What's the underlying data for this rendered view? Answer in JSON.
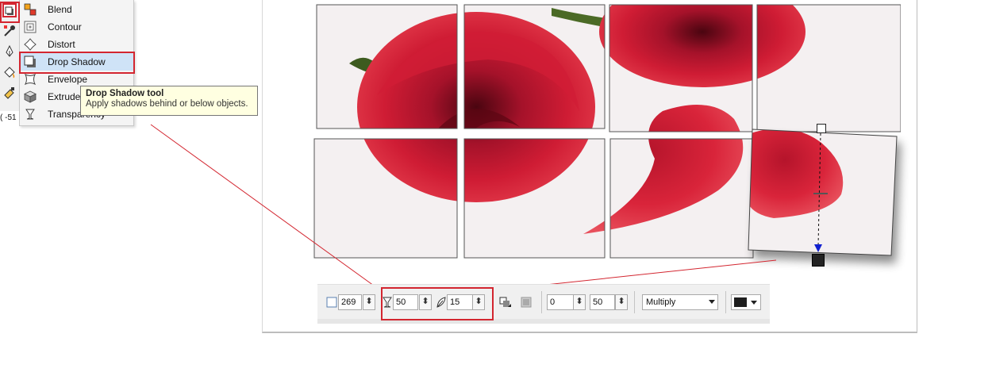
{
  "toolbox": {
    "coordinate_readout": "( -51"
  },
  "flyout_menu": {
    "items": [
      {
        "label": "Blend",
        "icon": "blend-icon"
      },
      {
        "label": "Contour",
        "icon": "contour-icon"
      },
      {
        "label": "Distort",
        "icon": "distort-icon"
      },
      {
        "label": "Drop Shadow",
        "icon": "drop-shadow-icon",
        "selected": true
      },
      {
        "label": "Envelope",
        "icon": "envelope-icon"
      },
      {
        "label": "Extrude",
        "icon": "extrude-icon"
      },
      {
        "label": "Transparency",
        "icon": "transparency-icon"
      }
    ]
  },
  "tooltip": {
    "title": "Drop Shadow tool",
    "description": "Apply shadows behind or below objects."
  },
  "property_bar": {
    "shadow_angle": "269",
    "shadow_opacity": "50",
    "shadow_feathering": "15",
    "shadow_fade": "0",
    "shadow_stretch": "50",
    "merge_mode": "Multiply",
    "shadow_color": "#1e1e1e"
  },
  "colors": {
    "highlight": "#d32630",
    "rose_red": "#c0172b",
    "selection_blue": "#cfe3f7",
    "tooltip_bg": "#ffffe1"
  }
}
